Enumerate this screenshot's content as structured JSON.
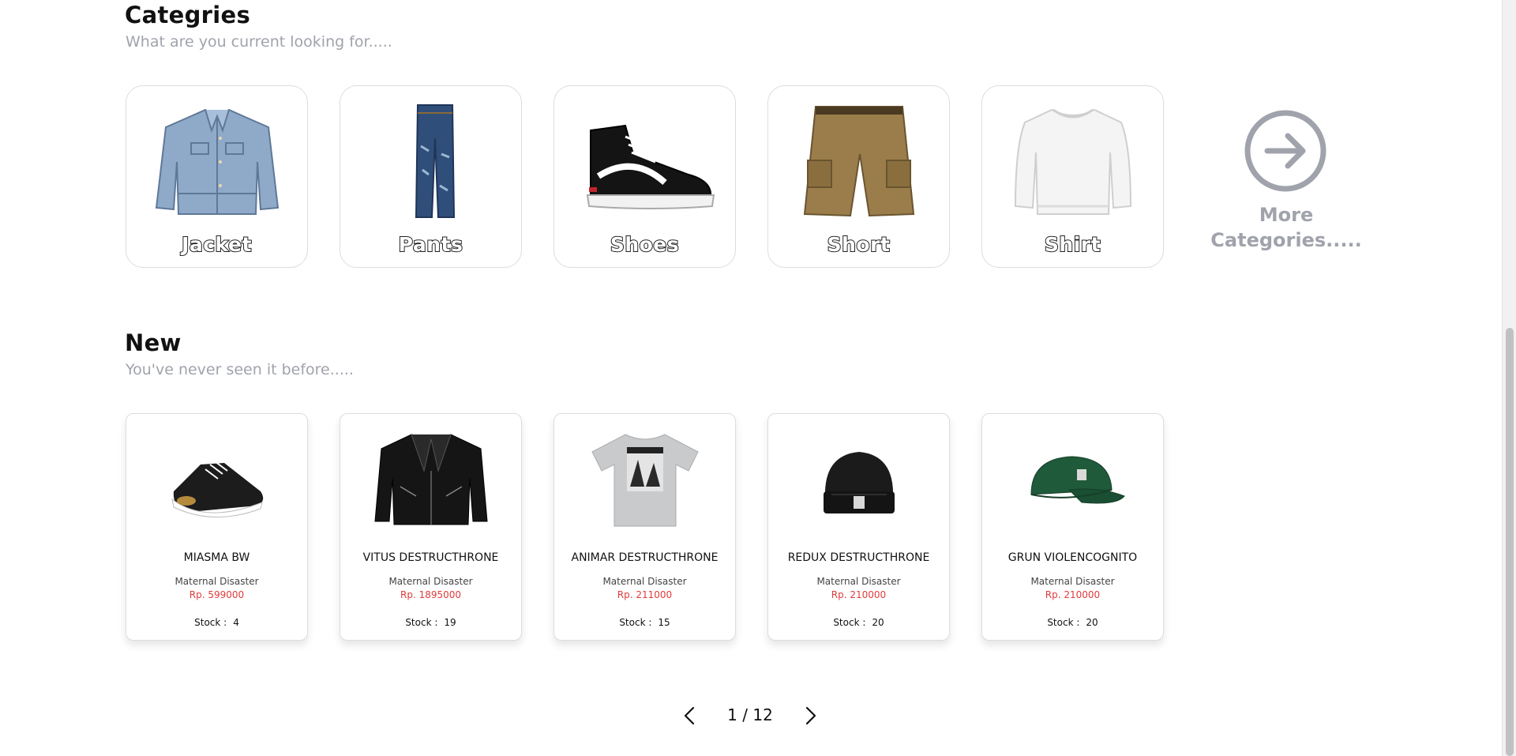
{
  "categories": {
    "title": "Categries",
    "subtitle": "What are you current looking for.....",
    "items": [
      {
        "label": "Jacket"
      },
      {
        "label": "Pants"
      },
      {
        "label": "Shoes"
      },
      {
        "label": "Short"
      },
      {
        "label": "Shirt"
      }
    ],
    "more_line1": "More",
    "more_line2": "Categories.....",
    "more_icon": "arrow-right-circle-icon"
  },
  "new_section": {
    "title": "New",
    "subtitle": "You've never seen it before.....",
    "products": [
      {
        "name": "MIASMA BW",
        "brand": "Maternal Disaster",
        "price": "Rp. 599000",
        "stock_label": "Stock :",
        "stock": "4"
      },
      {
        "name": "VITUS DESTRUCTHRONE",
        "brand": "Maternal Disaster",
        "price": "Rp. 1895000",
        "stock_label": "Stock :",
        "stock": "19"
      },
      {
        "name": "ANIMAR DESTRUCTHRONE",
        "brand": "Maternal Disaster",
        "price": "Rp. 211000",
        "stock_label": "Stock :",
        "stock": "15"
      },
      {
        "name": "REDUX DESTRUCTHRONE",
        "brand": "Maternal Disaster",
        "price": "Rp. 210000",
        "stock_label": "Stock :",
        "stock": "20"
      },
      {
        "name": "GRUN VIOLENCOGNITO",
        "brand": "Maternal Disaster",
        "price": "Rp. 210000",
        "stock_label": "Stock :",
        "stock": "20"
      }
    ]
  },
  "pagination": {
    "text": "1 / 12",
    "current_page": 1,
    "total_pages": 12,
    "prev_icon": "chevron-left-icon",
    "next_icon": "chevron-right-icon"
  },
  "colors": {
    "accent_muted": "#a0a3ac",
    "price": "#e23b3b",
    "card_border": "#dadde2"
  }
}
